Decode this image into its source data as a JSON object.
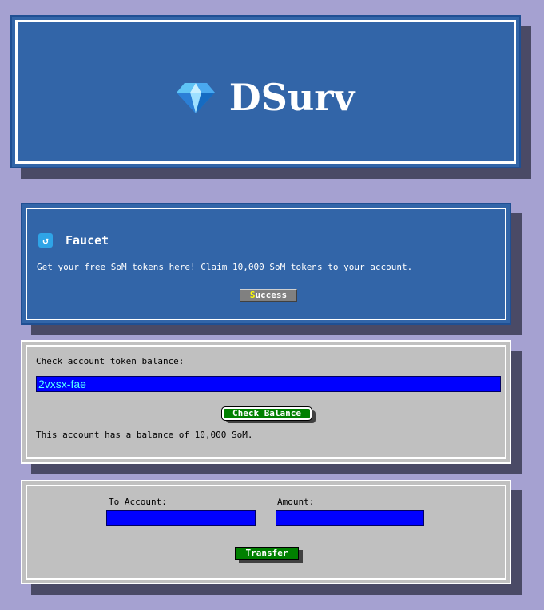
{
  "header": {
    "brand": "DSurv",
    "icon": "diamond-icon"
  },
  "faucet": {
    "title": "Faucet",
    "icon": "faucet-icon",
    "description": "Get your free SoM tokens here! Claim 10,000 SoM tokens to your account.",
    "button_hotkey": "S",
    "button_rest": "uccess"
  },
  "balance": {
    "label": "Check account token balance:",
    "account_value": "2vxsx-fae",
    "button_label": "Check Balance",
    "result": "This account has a balance of 10,000 SoM."
  },
  "transfer": {
    "to_label": "To Account:",
    "amount_label": "Amount:",
    "to_value": "",
    "amount_value": "",
    "button_label": "Transfer"
  },
  "colors": {
    "background": "#a5a1d1",
    "panel_blue": "#3265a8",
    "panel_gray": "#c0c0c0",
    "input_blue": "#0000ff",
    "button_green": "#008000"
  }
}
